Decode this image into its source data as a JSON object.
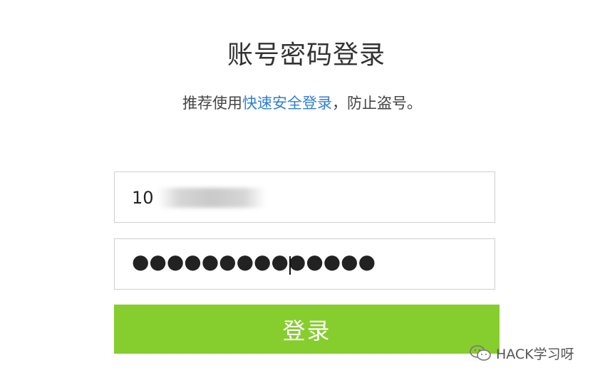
{
  "header": {
    "title": "账号密码登录",
    "subtitle_prefix": "推荐使用",
    "subtitle_link": "快速安全登录",
    "subtitle_suffix": "，防止盗号。"
  },
  "form": {
    "account_value": "10",
    "password_dots": "●●●●●●●●●●●●●●",
    "login_label": "登录"
  },
  "watermark": {
    "icon": "wechat-icon",
    "text": "HACK学习呀"
  }
}
